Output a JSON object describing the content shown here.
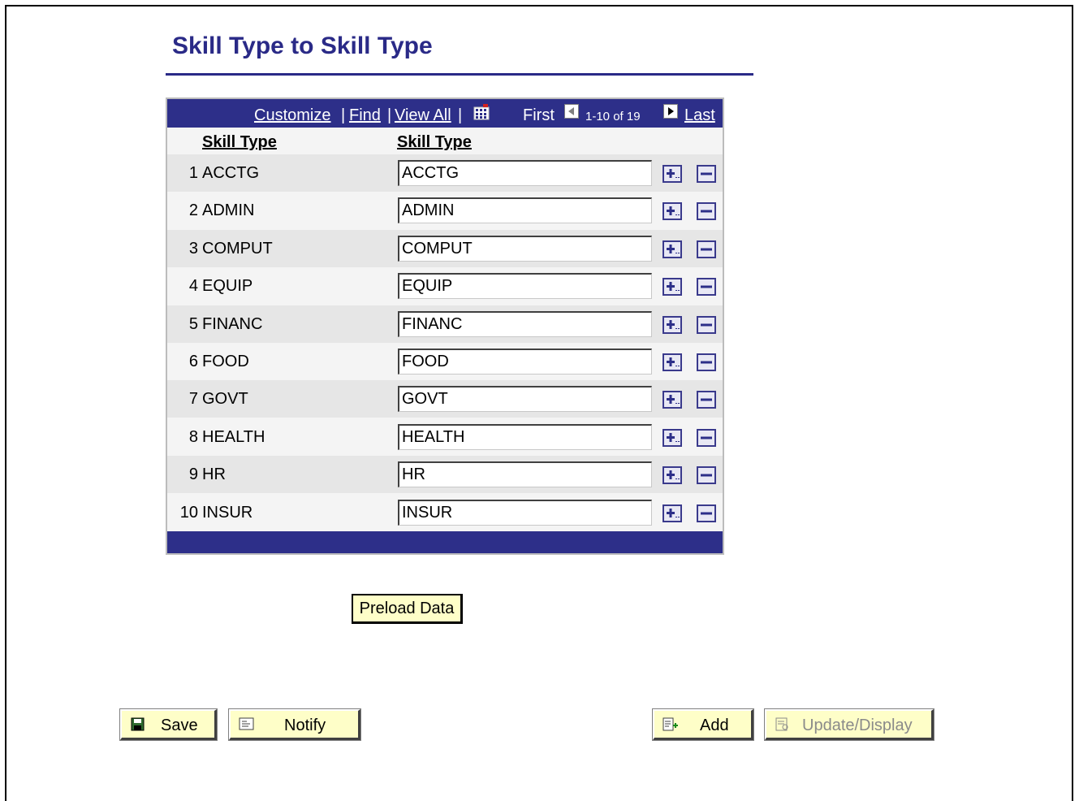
{
  "page": {
    "title": "Skill Type to Skill Type"
  },
  "grid": {
    "nav": {
      "customize": "Customize",
      "find": "Find",
      "view_all": "View All",
      "sep": "|",
      "first": "First",
      "range": "1-10 of 19",
      "last": "Last"
    },
    "columns": [
      "Skill Type",
      "Skill Type"
    ],
    "rows": [
      {
        "num": "1",
        "code": "ACCTG",
        "value": "ACCTG"
      },
      {
        "num": "2",
        "code": "ADMIN",
        "value": "ADMIN"
      },
      {
        "num": "3",
        "code": "COMPUT",
        "value": "COMPUT"
      },
      {
        "num": "4",
        "code": "EQUIP",
        "value": "EQUIP"
      },
      {
        "num": "5",
        "code": "FINANC",
        "value": "FINANC"
      },
      {
        "num": "6",
        "code": "FOOD",
        "value": "FOOD"
      },
      {
        "num": "7",
        "code": "GOVT",
        "value": "GOVT"
      },
      {
        "num": "8",
        "code": "HEALTH",
        "value": "HEALTH"
      },
      {
        "num": "9",
        "code": "HR",
        "value": "HR"
      },
      {
        "num": "10",
        "code": "INSUR",
        "value": "INSUR"
      }
    ]
  },
  "buttons": {
    "preload": "Preload Data",
    "save": "Save",
    "notify": "Notify",
    "add": "Add",
    "update_display": "Update/Display"
  },
  "colors": {
    "header_blue": "#2d2f89",
    "title": "#2a2a87",
    "button_bg": "#fefec8"
  },
  "icons": [
    "grid-icon",
    "first-arrow-icon",
    "next-arrow-icon",
    "add-row-icon",
    "delete-row-icon",
    "save-icon",
    "notify-icon",
    "add-icon",
    "update-display-icon"
  ]
}
